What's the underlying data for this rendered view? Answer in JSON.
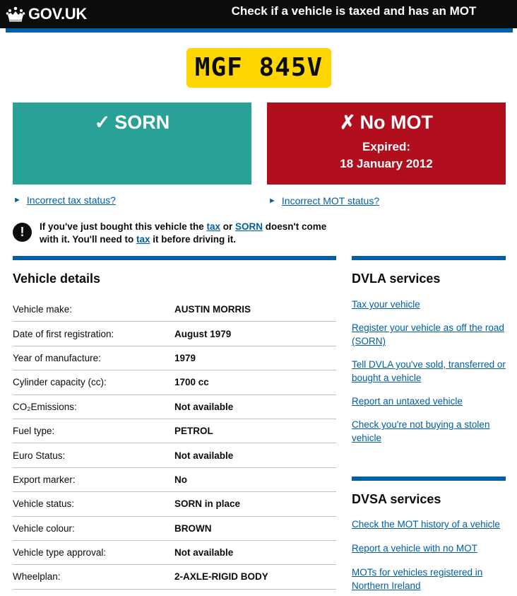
{
  "header": {
    "brand": "GOV.UK",
    "service_title": "Check if a vehicle is taxed and has an MOT"
  },
  "registration": "MGF 845V",
  "tax_status": {
    "icon": "tick-icon",
    "mark": "✓",
    "label": "SORN",
    "color": "#28a197"
  },
  "mot_status": {
    "icon": "cross-icon",
    "mark": "✗",
    "label": "No MOT",
    "line1": "Expired:",
    "line2": "18 January 2012",
    "color": "#b10e1e"
  },
  "links": {
    "incorrect_tax": "Incorrect tax status?",
    "incorrect_mot": "Incorrect MOT status?"
  },
  "warning": {
    "icon": "!",
    "p1": "If you've just bought this vehicle the ",
    "link_tax": "tax",
    "p2": " or ",
    "link_sorn": "SORN",
    "p3": " doesn't come with it. You'll need to ",
    "link_tax2": "tax",
    "p4": " it before driving it."
  },
  "vehicle_details": {
    "title": "Vehicle details",
    "rows": [
      {
        "label": "Vehicle make:",
        "value": "AUSTIN MORRIS"
      },
      {
        "label": "Date of first registration:",
        "value": "August 1979"
      },
      {
        "label": "Year of manufacture:",
        "value": "1979"
      },
      {
        "label": "Cylinder capacity (cc):",
        "value": "1700 cc"
      },
      {
        "label": "CO₂Emissions:",
        "value": "Not available"
      },
      {
        "label": "Fuel type:",
        "value": "PETROL"
      },
      {
        "label": "Euro Status:",
        "value": "Not available"
      },
      {
        "label": "Export marker:",
        "value": "No"
      },
      {
        "label": "Vehicle status:",
        "value": "SORN in place"
      },
      {
        "label": "Vehicle colour:",
        "value": "BROWN"
      },
      {
        "label": "Vehicle type approval:",
        "value": "Not available"
      },
      {
        "label": "Wheelplan:",
        "value": "2-AXLE-RIGID BODY"
      }
    ]
  },
  "dvla": {
    "title": "DVLA services",
    "links": [
      "Tax your vehicle",
      "Register your vehicle as off the road (SORN)",
      "Tell DVLA you've sold, transferred or bought a vehicle",
      "Report an untaxed vehicle",
      "Check you're not buying a stolen vehicle"
    ]
  },
  "dvsa": {
    "title": "DVSA services",
    "links": [
      "Check the MOT history of a vehicle",
      "Report a vehicle with no MOT",
      "MOTs for vehicles registered in Northern Ireland"
    ]
  }
}
